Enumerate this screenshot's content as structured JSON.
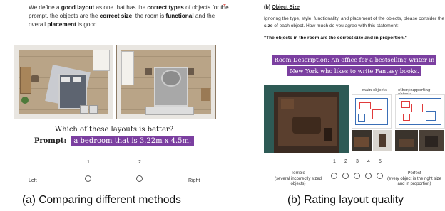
{
  "left_panel": {
    "intro_parts": [
      {
        "text": "We define a ",
        "bold": false
      },
      {
        "text": "good layout",
        "bold": true
      },
      {
        "text": " as one that has the ",
        "bold": false
      },
      {
        "text": "correct types",
        "bold": true
      },
      {
        "text": " of objects for the prompt, the objects are the ",
        "bold": false
      },
      {
        "text": "correct size",
        "bold": true
      },
      {
        "text": ", the room is ",
        "bold": false
      },
      {
        "text": "functional",
        "bold": true
      },
      {
        "text": " and the overall ",
        "bold": false
      },
      {
        "text": "placement",
        "bold": true
      },
      {
        "text": " is good.",
        "bold": false
      }
    ],
    "required_marker": "*",
    "question": "Which of these layouts is better?",
    "prompt_label": "Prompt:",
    "prompt_text": "a bedroom that is 3.22m x 4.5m.",
    "options": [
      {
        "number": "1"
      },
      {
        "number": "2"
      }
    ],
    "left_label": "Left",
    "right_label": "Right",
    "caption": "(a) Comparing different methods"
  },
  "right_panel": {
    "section_prefix": "(b) ",
    "section_title": "Object Size",
    "instructions_pre": "Ignoring the type, style, functionality, and placement of the objects, please consider the ",
    "instructions_bold": "size",
    "instructions_post": " of each object. How much do you agree with this statement:",
    "statement": "\"The objects in the room are the correct size and in proportion.\"",
    "room_description": "Room Description: An office for a bestselling writer in New York who likes to write Fantasy books.",
    "main_objects_label": "main objects",
    "other_objects_label": "other/supporting objects",
    "scale": [
      "1",
      "2",
      "3",
      "4",
      "5"
    ],
    "low_label": "Terrible",
    "low_sub": "(several incorrectly sized objects)",
    "high_label": "Perfect",
    "high_sub": "(every object is the right size and in proportion)",
    "caption": "(b) Rating layout quality"
  },
  "colors": {
    "highlight_purple": "#7b3fa0",
    "required_red": "#d93025",
    "floor_wood": "#b9a487"
  }
}
